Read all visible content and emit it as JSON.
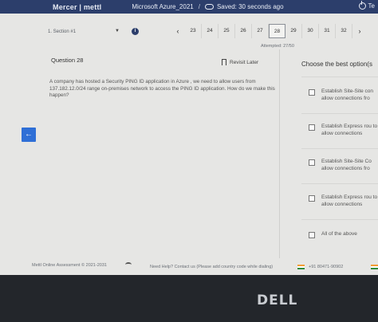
{
  "topbar": {
    "brand": "Mercer | mettl",
    "test_name": "Microsoft Azure_2021",
    "save_status": "Saved: 30 seconds ago",
    "power_label": "Te"
  },
  "nav": {
    "section": "1. Section #1",
    "info_label": "i",
    "prev_arrow": "‹",
    "next_arrow": "›",
    "pages": [
      "23",
      "24",
      "25",
      "26",
      "27",
      "28",
      "29",
      "30",
      "31",
      "32"
    ],
    "active_page": "28",
    "attempted": "Attempted: 27/50"
  },
  "question": {
    "label": "Question 28",
    "revisit_label": "Revisit Later",
    "text": "A company has hosted a Security PING ID application in Azure , we need to allow users from 137.182.12.0/24 range on-premises network to access the PING ID application. How do we make this happen?"
  },
  "back_button": "←",
  "options": {
    "title": "Choose the best option(s",
    "items": [
      "Establish Site-Site con allow connections fro",
      "Establish Express rou to allow connections",
      "Establish Site-Site Co allow connections fro",
      "Establish Express rou to allow connections",
      "All of the above"
    ]
  },
  "footer": {
    "copyright": "Mettl Online Assessment © 2021-2031",
    "help": "Need Help? Contact us (Please add country code while dialing)",
    "phone": "+91 80471-90902"
  },
  "device_brand": "DELL"
}
